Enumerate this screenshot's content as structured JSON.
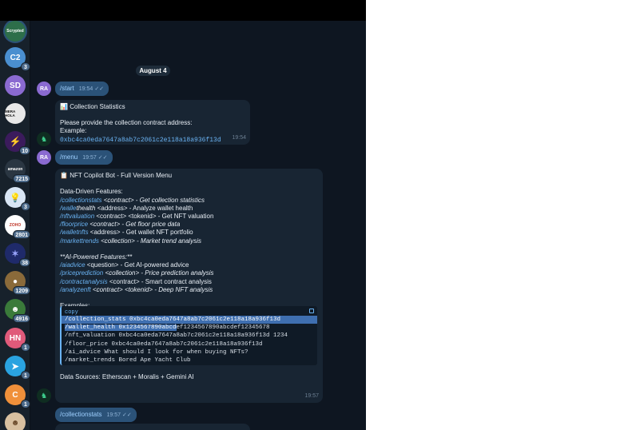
{
  "sidebar": {
    "chats": [
      {
        "label": "Scrypted",
        "color": "#2d6e4a",
        "badge": ""
      },
      {
        "label": "C2",
        "color": "#4a8fd0",
        "badge": "3"
      },
      {
        "label": "SD",
        "color": "#8a6ad1",
        "badge": ""
      },
      {
        "label": "MERA HOLA",
        "color": "#e8e8e8",
        "badge": ""
      },
      {
        "label": "",
        "color": "#3b1b5c",
        "badge": "10"
      },
      {
        "label": "amazon",
        "color": "#2a3642",
        "badge": "7215"
      },
      {
        "label": "",
        "color": "#d9e6f5",
        "badge": "3"
      },
      {
        "label": "ZOHO",
        "color": "#ffffff",
        "badge": "2801"
      },
      {
        "label": "",
        "color": "#1f2a6a",
        "badge": "38"
      },
      {
        "label": "",
        "color": "#8a6a3a",
        "badge": "1209"
      },
      {
        "label": "",
        "color": "#3a7a3a",
        "badge": "4916"
      },
      {
        "label": "HN",
        "color": "#e05a7a",
        "badge": "1"
      },
      {
        "label": "",
        "color": "#2aa3e0",
        "badge": "1"
      },
      {
        "label": "C",
        "color": "#f0903a",
        "badge": "1"
      },
      {
        "label": "",
        "color": "#d8c0a0",
        "badge": ""
      }
    ]
  },
  "chat": {
    "date": "August 4",
    "user_initials": "RA",
    "msg1": {
      "text": "/start",
      "time": "19:54"
    },
    "msg2": {
      "title": "Collection Statistics",
      "body": "Please provide the collection contract address:",
      "example_label": "Example:",
      "example": "0xbc4ca0eda7647a8ab7c2061c2e118a18a936f13d",
      "time": "19:54"
    },
    "msg3": {
      "text": "/menu",
      "time": "19:57"
    },
    "msg4": {
      "title": "NFT Copilot Bot - Full Version Menu",
      "section1": "Data-Driven Features:",
      "f1": {
        "cmd": "/collectionstats",
        "rest": " <contract> - Get collection statistics"
      },
      "f2": {
        "cmd": "/walle",
        "cmd2": "thealth",
        "rest": " <address> - Analyze wallet health"
      },
      "f3": {
        "cmd": "/nftvaluation",
        "rest": " <contract> <tokenid> - Get NFT valuation"
      },
      "f4": {
        "cmd": "/floorprice",
        "rest": " <contract> - Get floor price data"
      },
      "f5": {
        "cmd": "/walletnfts",
        "rest": " <address> - Get wallet NFT portfolio"
      },
      "f6": {
        "cmd": "/markettrends",
        "rest": " <collection> - Market trend analysis"
      },
      "section2": "**AI-Powered Features:**",
      "a1": {
        "cmd": "/aiadvice",
        "rest": " <question> - Get AI-powered advice"
      },
      "a2": {
        "cmd": "/priceprediction",
        "rest": " <collection> - Price prediction analysis"
      },
      "a3": {
        "cmd": "/contractanalysis",
        "rest": " <contract> - Smart contract analysis"
      },
      "a4": {
        "cmd": "/analyzenft",
        "rest": " <contract> <tokenid> - Deep NFT analysis"
      },
      "examples_label": "Examples:",
      "code_lang": "copy",
      "code": [
        "/collection_stats 0xbc4ca0eda7647a8ab7c2061c2e118a18a936f13d",
        "/wallet_health 0x1234567890abcdef1234567890abcdef12345678",
        "/nft_valuation 0xbc4ca0eda7647a8ab7c2061c2e118a18a936f13d 1234",
        "/floor_price 0xbc4ca0eda7647a8ab7c2061c2e118a18a936f13d",
        "/ai_advice What should I look for when buying NFTs?",
        "/market_trends Bored Ape Yacht Club"
      ],
      "sources": "Data Sources: Etherscan + Moralis + Gemini AI",
      "time": "19:57"
    },
    "msg5": {
      "text": "/collectionstats",
      "time": "19:57"
    }
  }
}
